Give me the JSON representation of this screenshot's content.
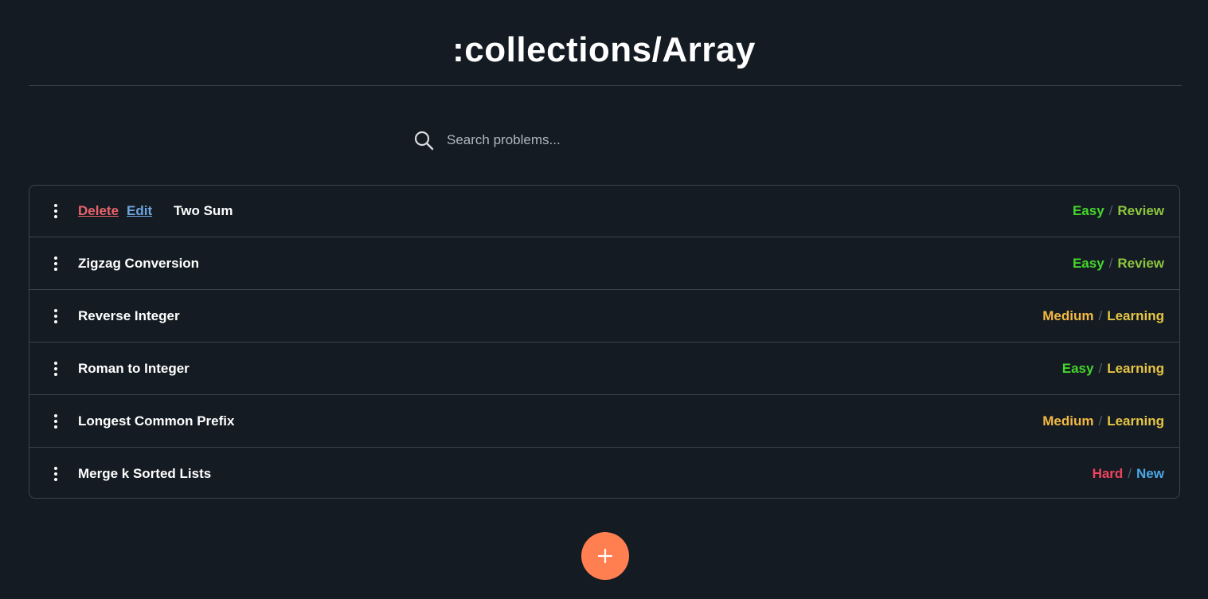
{
  "title": ":collections/Array",
  "search": {
    "placeholder": "Search problems..."
  },
  "colors": {
    "background": "#141b22",
    "easy": "#44d62c",
    "medium": "#f4b942",
    "hard": "#f0435f",
    "review": "#8cc63f",
    "learning": "#e6c545",
    "new": "#4aa8e8",
    "delete": "#e8636b",
    "edit": "#6fa5e0",
    "fab": "#ff7f50"
  },
  "actions": {
    "delete_label": "Delete",
    "edit_label": "Edit"
  },
  "problems": [
    {
      "name": "Two Sum",
      "difficulty": "Easy",
      "status": "Review"
    },
    {
      "name": "Zigzag Conversion",
      "difficulty": "Easy",
      "status": "Review"
    },
    {
      "name": "Reverse Integer",
      "difficulty": "Medium",
      "status": "Learning"
    },
    {
      "name": "Roman to Integer",
      "difficulty": "Easy",
      "status": "Learning"
    },
    {
      "name": "Longest Common Prefix",
      "difficulty": "Medium",
      "status": "Learning"
    },
    {
      "name": "Merge k Sorted Lists",
      "difficulty": "Hard",
      "status": "New"
    }
  ],
  "separator": "/",
  "fab": {
    "icon": "plus-icon"
  }
}
